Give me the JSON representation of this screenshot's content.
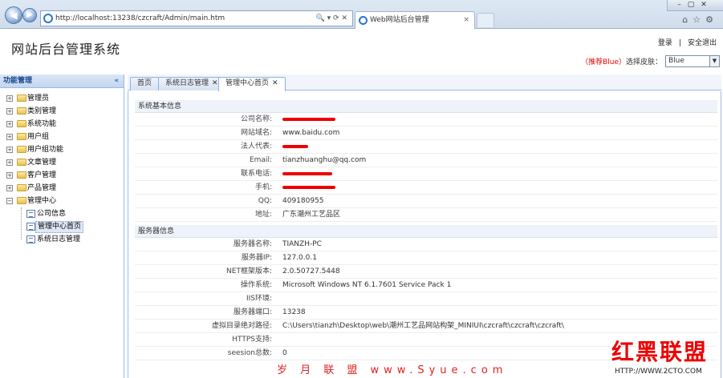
{
  "browser": {
    "url": "http://localhost:13238/czcraft/Admin/main.htm",
    "tab_title": "Web网站后台管理",
    "tab_close": "×"
  },
  "header": {
    "site_title": "网站后台管理系统",
    "login": "登录",
    "separator": "|",
    "logout": "安全退出",
    "skin_recommend": "（推荐Blue）",
    "skin_label": "选择皮肤：",
    "skin_value": "Blue"
  },
  "sidebar": {
    "title": "功能管理",
    "collapse": "«",
    "items": [
      {
        "label": "管理员"
      },
      {
        "label": "类别管理"
      },
      {
        "label": "系统功能"
      },
      {
        "label": "用户组"
      },
      {
        "label": "用户组功能"
      },
      {
        "label": "文章管理"
      },
      {
        "label": "客户管理"
      },
      {
        "label": "产品管理"
      },
      {
        "label": "管理中心"
      }
    ],
    "children": [
      {
        "label": "公司信息"
      },
      {
        "label": "管理中心首页"
      },
      {
        "label": "系统日志管理"
      }
    ]
  },
  "tabs": [
    {
      "label": "首页"
    },
    {
      "label": "系统日志管理"
    },
    {
      "label": "管理中心首页"
    }
  ],
  "basic_section": "系统基本信息",
  "basic_info": [
    {
      "key": "公司名称:",
      "value": ""
    },
    {
      "key": "网站域名:",
      "value": "www.baidu.com"
    },
    {
      "key": "法人代表:",
      "value": ""
    },
    {
      "key": "Email:",
      "value": "tianzhuanghu@qq.com"
    },
    {
      "key": "联系电话:",
      "value": ""
    },
    {
      "key": "手机:",
      "value": ""
    },
    {
      "key": "QQ:",
      "value": "409180955"
    },
    {
      "key": "地址:",
      "value": "广东潮州工艺品区"
    }
  ],
  "server_section": "服务器信息",
  "server_info": [
    {
      "key": "服务器名称:",
      "value": "TIANZH-PC"
    },
    {
      "key": "服务器IP:",
      "value": "127.0.0.1"
    },
    {
      "key": "NET框架版本:",
      "value": "2.0.50727.5448"
    },
    {
      "key": "操作系统:",
      "value": "Microsoft Windows NT 6.1.7601 Service Pack 1"
    },
    {
      "key": "IIS环境:",
      "value": ""
    },
    {
      "key": "服务器端口:",
      "value": "13238"
    },
    {
      "key": "虚拟目录绝对路径:",
      "value": "C:\\Users\\tianzh\\Desktop\\web\\潮州工艺品网站构架_MINIUI\\czcraft\\czcraft\\czcraft\\"
    },
    {
      "key": "HTTPS支持:",
      "value": ""
    },
    {
      "key": "seesion总数:",
      "value": "0"
    }
  ],
  "watermarks": {
    "left": "岁 月 联 盟  www.Syue.com",
    "right_big": "红黑联盟",
    "right_small": "HTTP://WWW.2CTO.COM"
  }
}
